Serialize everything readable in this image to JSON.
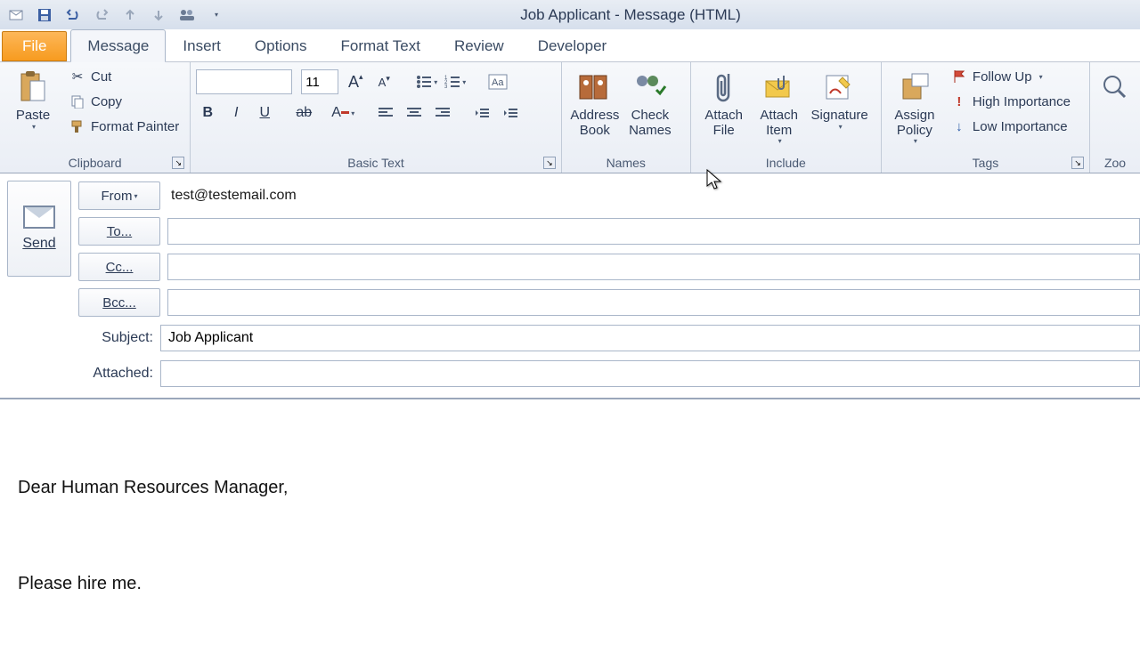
{
  "window": {
    "title": "Job Applicant - Message (HTML)"
  },
  "tabs": {
    "file": "File",
    "message": "Message",
    "insert": "Insert",
    "options": "Options",
    "format_text": "Format Text",
    "review": "Review",
    "developer": "Developer"
  },
  "ribbon": {
    "clipboard": {
      "label": "Clipboard",
      "paste": "Paste",
      "cut": "Cut",
      "copy": "Copy",
      "format_painter": "Format Painter"
    },
    "basic_text": {
      "label": "Basic Text",
      "font": "",
      "size": "11"
    },
    "names": {
      "label": "Names",
      "address_book": "Address\nBook",
      "check_names": "Check\nNames"
    },
    "include": {
      "label": "Include",
      "attach_file": "Attach\nFile",
      "attach_item": "Attach\nItem",
      "signature": "Signature"
    },
    "tags": {
      "label": "Tags",
      "assign_policy": "Assign\nPolicy",
      "follow_up": "Follow Up",
      "high_importance": "High Importance",
      "low_importance": "Low Importance"
    },
    "zoom": {
      "label": "Zoom",
      "zoom": "Zoo"
    }
  },
  "compose": {
    "send": "Send",
    "from_btn": "From",
    "from_value": "test@testemail.com",
    "to_btn": "To...",
    "to_value": "",
    "cc_btn": "Cc...",
    "cc_value": "",
    "bcc_btn": "Bcc...",
    "bcc_value": "",
    "subject_label": "Subject:",
    "subject_value": "Job Applicant",
    "attached_label": "Attached:",
    "attached_value": ""
  },
  "body": {
    "line1": "Dear Human Resources Manager,",
    "line2": "Please hire me."
  }
}
